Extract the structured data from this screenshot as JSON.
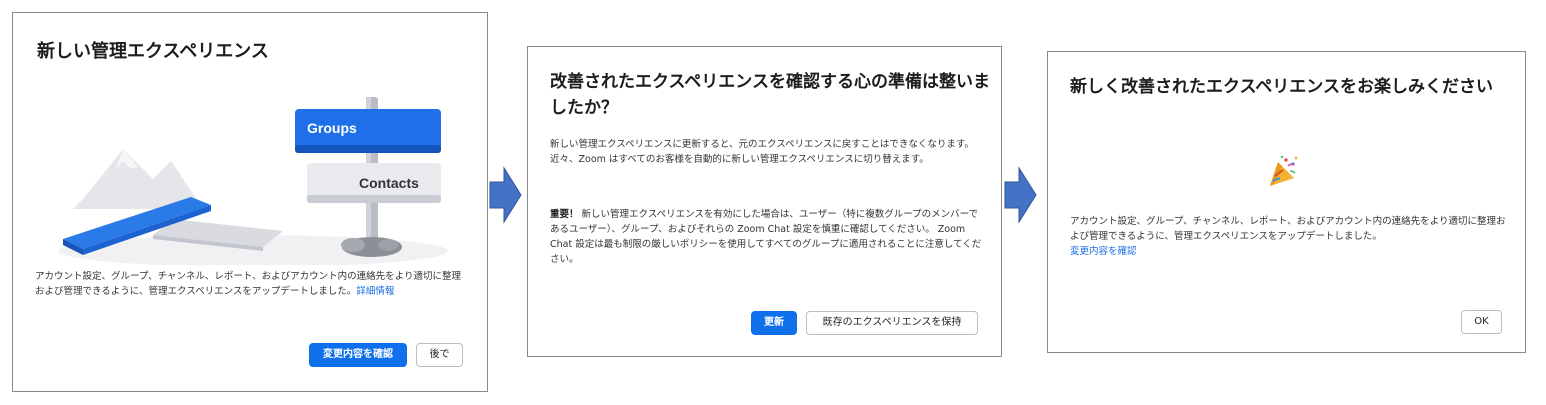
{
  "panel1": {
    "title": "新しい管理エクスペリエンス",
    "sign_groups": "Groups",
    "sign_contacts": "Contacts",
    "body": "アカウント設定、グループ、チャンネル、レポート、およびアカウント内の連絡先をより適切に整理および管理できるように、管理エクスペリエンスをアップデートしました。",
    "link": "詳細情報",
    "primary_button": "変更内容を確認",
    "secondary_button": "後で"
  },
  "panel2": {
    "title": "改善されたエクスペリエンスを確認する心の準備は整いましたか？",
    "para1": "新しい管理エクスペリエンスに更新すると、元のエクスペリエンスに戻すことはできなくなります。 近々、Zoom はすべてのお客様を自動的に新しい管理エクスペリエンスに切り替えます。",
    "para2_strong": "重要！",
    "para2": "新しい管理エクスペリエンスを有効にした場合は、ユーザー（特に複数グループのメンバーであるユーザー）、グループ、およびそれらの Zoom Chat 設定を慎重に確認してください。 Zoom Chat 設定は最も制限の厳しいポリシーを使用してすべてのグループに適用されることに注意してください。",
    "primary_button": "更新",
    "secondary_button": "既存のエクスペリエンスを保持"
  },
  "panel3": {
    "title": "新しく改善されたエクスペリエンスをお楽しみください",
    "body": "アカウント設定、グループ、チャンネル、レポート、およびアカウント内の連絡先をより適切に整理および管理できるように、管理エクスペリエンスをアップデートしました。",
    "link": "変更内容を確認",
    "ok_button": "OK"
  },
  "icons": {
    "arrow": "right-arrow-icon",
    "party": "party-popper-icon",
    "illustration": "signpost-illustration"
  },
  "colors": {
    "primary": "#0e71eb",
    "link": "#1a6ee6",
    "arrow": "#4472c4",
    "sign_blue": "#1f6fe8"
  }
}
